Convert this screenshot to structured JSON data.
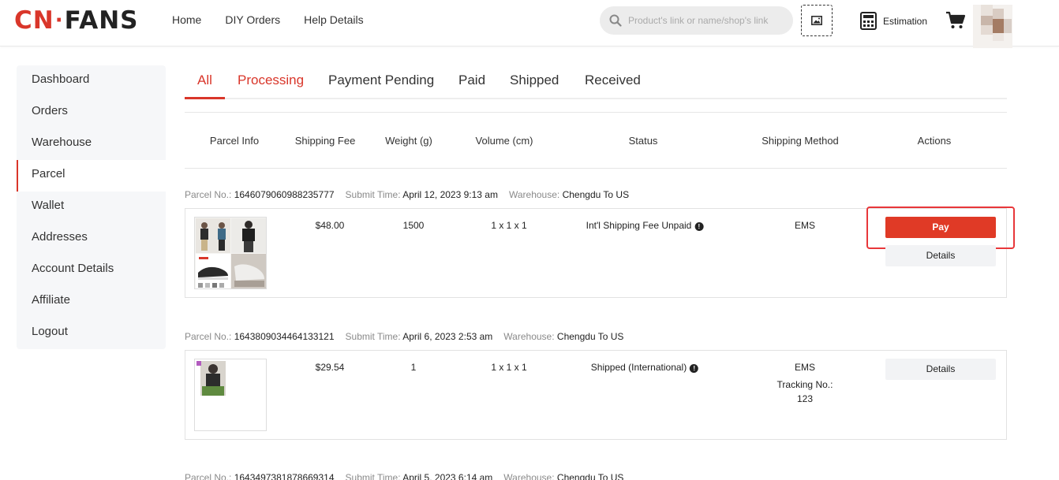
{
  "brand": {
    "logo_cn": "CN",
    "logo_dot": "·",
    "logo_fans": "FANS",
    "accent": "#d9362a"
  },
  "nav": {
    "home": "Home",
    "diy_orders": "DIY Orders",
    "help": "Help Details"
  },
  "search": {
    "placeholder": "Product's link or name/shop's link",
    "icon": "search-icon"
  },
  "header_actions": {
    "estimation": "Estimation"
  },
  "sidebar": {
    "items": [
      {
        "label": "Dashboard"
      },
      {
        "label": "Orders"
      },
      {
        "label": "Warehouse"
      },
      {
        "label": "Parcel",
        "active": true
      },
      {
        "label": "Wallet"
      },
      {
        "label": "Addresses"
      },
      {
        "label": "Account Details"
      },
      {
        "label": "Affiliate"
      },
      {
        "label": "Logout"
      }
    ]
  },
  "tabs": [
    "All",
    "Processing",
    "Payment Pending",
    "Paid",
    "Shipped",
    "Received"
  ],
  "columns": [
    "Parcel Info",
    "Shipping Fee",
    "Weight (g)",
    "Volume (cm)",
    "Status",
    "Shipping Method",
    "Actions"
  ],
  "labels": {
    "parcel_no": "Parcel No.:",
    "submit_time": "Submit Time:",
    "warehouse": "Warehouse:",
    "tracking": "Tracking No.:",
    "pay": "Pay",
    "details": "Details"
  },
  "parcels": [
    {
      "parcel_no": "1646079060988235777",
      "submit_time": "April 12, 2023 9:13 am",
      "warehouse": "Chengdu To US",
      "fee": "$48.00",
      "weight": "1500",
      "volume": "1 x 1 x 1",
      "status": "Int'l Shipping Fee Unpaid",
      "method": "EMS"
    },
    {
      "parcel_no": "1643809034464133121",
      "submit_time": "April 6, 2023 2:53 am",
      "warehouse": "Chengdu To US",
      "fee": "$29.54",
      "weight": "1",
      "volume": "1 x 1 x 1",
      "status": "Shipped (International)",
      "method": "EMS",
      "tracking_no": "123"
    },
    {
      "parcel_no": "1643497381878669314",
      "submit_time": "April 5, 2023 6:14 am",
      "warehouse": "Chengdu To US"
    }
  ]
}
